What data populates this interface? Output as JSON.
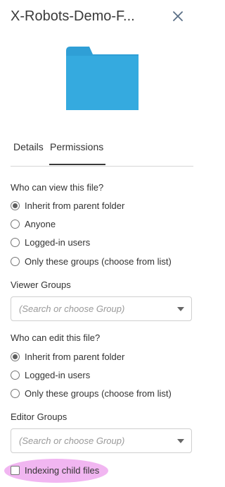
{
  "header": {
    "title": "X-Robots-Demo-F...",
    "close_icon": "close-icon"
  },
  "preview": {
    "icon": "folder-icon",
    "color": "#35aadf"
  },
  "tabs": [
    {
      "label": "Details",
      "active": false
    },
    {
      "label": "Permissions",
      "active": true
    }
  ],
  "view_permissions": {
    "question": "Who can view this file?",
    "options": [
      {
        "label": "Inherit from parent folder",
        "checked": true
      },
      {
        "label": "Anyone",
        "checked": false
      },
      {
        "label": "Logged-in users",
        "checked": false
      },
      {
        "label": "Only these groups (choose from list)",
        "checked": false
      }
    ],
    "groups_label": "Viewer Groups",
    "groups_placeholder": "(Search or choose Group)"
  },
  "edit_permissions": {
    "question": "Who can edit this file?",
    "options": [
      {
        "label": "Inherit from parent folder",
        "checked": true
      },
      {
        "label": "Logged-in users",
        "checked": false
      },
      {
        "label": "Only these groups (choose from list)",
        "checked": false
      }
    ],
    "groups_label": "Editor Groups",
    "groups_placeholder": "(Search or choose Group)"
  },
  "indexing": {
    "label": "Indexing child files",
    "checked": false,
    "highlight_color": "#f1b6f1"
  }
}
